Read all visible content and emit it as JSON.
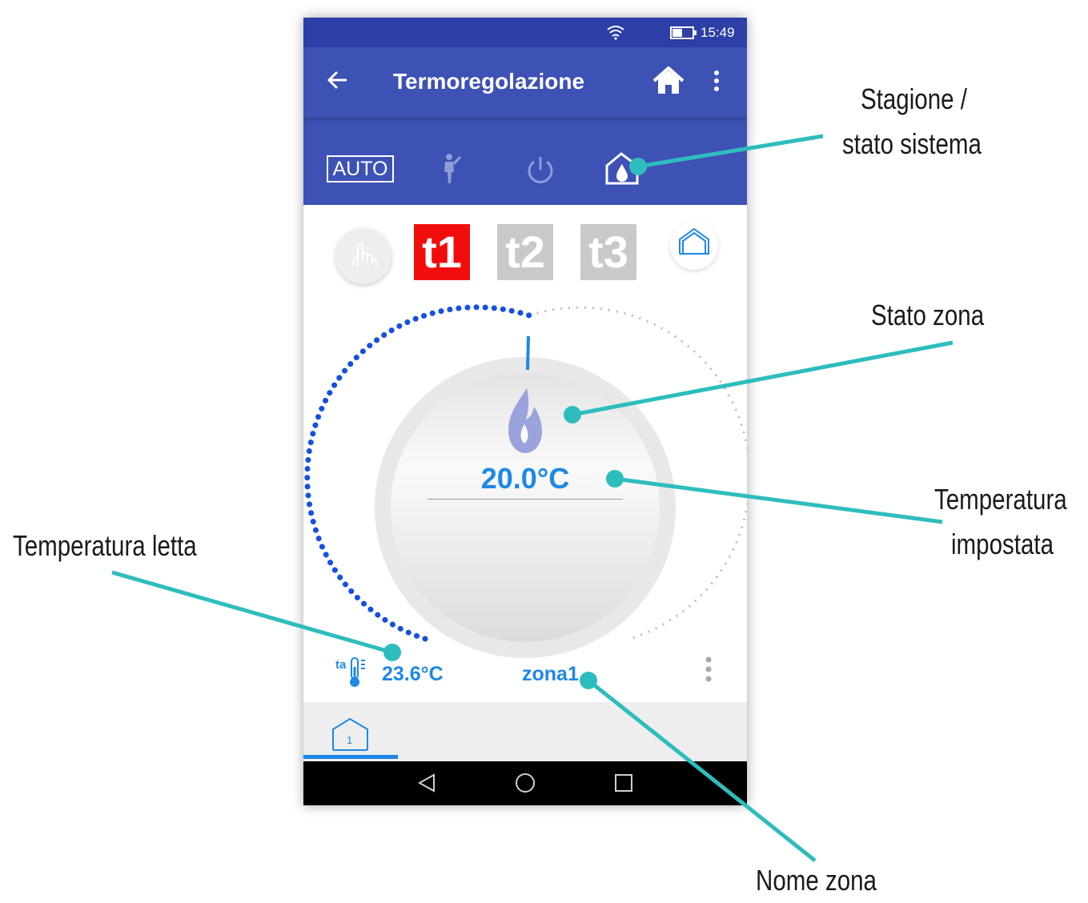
{
  "statusbar": {
    "time": "15:49"
  },
  "appbar": {
    "title": "Termoregolazione"
  },
  "modebar": {
    "auto_label": "AUTO"
  },
  "levels": {
    "t1": "t1",
    "t2": "t2",
    "t3": "t3",
    "active": "t1"
  },
  "dial": {
    "set_temperature": "20.0°C"
  },
  "zone": {
    "read_label": "ta",
    "read_temperature": "23.6°C",
    "name": "zona1"
  },
  "tabs": [
    {
      "number": "1"
    }
  ],
  "callouts": {
    "season_line1": "Stagione /",
    "season_line2": "stato sistema",
    "zone_state": "Stato zona",
    "set_temp_line1": "Temperatura",
    "set_temp_line2": "impostata",
    "read_temp": "Temperatura letta",
    "zone_name": "Nome zona"
  },
  "colors": {
    "appbar": "#3e51b5",
    "statusbar": "#2d3ea6",
    "accent_blue": "#1e88e5",
    "t1_active": "#f20d0d",
    "inactive_gray": "#c9c9c9",
    "callout_line": "#2ebdbd"
  }
}
